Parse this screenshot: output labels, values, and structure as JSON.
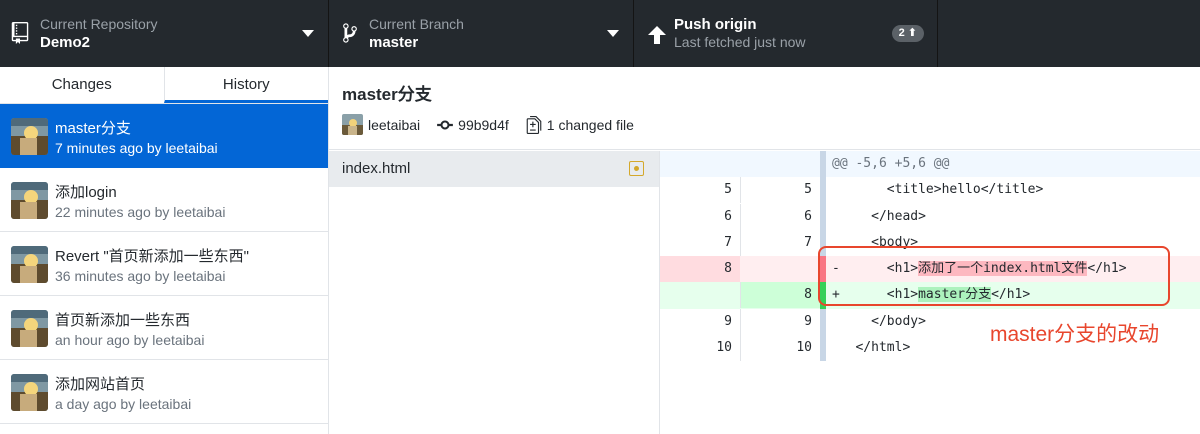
{
  "toolbar": {
    "repo": {
      "title": "Current Repository",
      "value": "Demo2",
      "icon": "repo-icon"
    },
    "branch": {
      "title": "Current Branch",
      "value": "master",
      "icon": "branch-icon"
    },
    "push": {
      "title": "Push origin",
      "subtitle": "Last fetched just now",
      "badge": "2",
      "icon": "arrow-up-icon"
    }
  },
  "tabs": {
    "changes": "Changes",
    "history": "History",
    "active": "History"
  },
  "commits": [
    {
      "title": "master分支",
      "meta": "7 minutes ago by leetaibai"
    },
    {
      "title": "添加login",
      "meta": "22 minutes ago by leetaibai"
    },
    {
      "title": "Revert \"首页新添加一些东西\"",
      "meta": "36 minutes ago by leetaibai"
    },
    {
      "title": "首页新添加一些东西",
      "meta": "an hour ago by leetaibai"
    },
    {
      "title": "添加网站首页",
      "meta": "a day ago by leetaibai"
    }
  ],
  "commit_detail": {
    "title": "master分支",
    "author": "leetaibai",
    "sha": "99b9d4f",
    "changed": "1 changed file"
  },
  "files": [
    {
      "name": "index.html",
      "status": "modified"
    }
  ],
  "diff": {
    "hunk": "@@ -5,6 +5,6 @@",
    "lines": [
      {
        "old": "5",
        "new": "5",
        "prefix": " ",
        "text": "    <title>hello</title>"
      },
      {
        "old": "6",
        "new": "6",
        "prefix": " ",
        "text": "  </head>"
      },
      {
        "old": "7",
        "new": "7",
        "prefix": " ",
        "text": "  <body>"
      },
      {
        "old": "8",
        "new": "",
        "prefix": "-",
        "pre": "    <h1>",
        "hl": "添加了一个index.html文件",
        "post": "</h1>"
      },
      {
        "old": "",
        "new": "8",
        "prefix": "+",
        "pre": "    <h1>",
        "hl": "master分支",
        "post": "</h1>"
      },
      {
        "old": "9",
        "new": "9",
        "prefix": " ",
        "text": "  </body>"
      },
      {
        "old": "10",
        "new": "10",
        "prefix": " ",
        "text": "</html>"
      }
    ]
  },
  "annotation": {
    "text": "master分支的改动",
    "color": "#e8462d"
  },
  "colors": {
    "toolbar": "#24292e",
    "accent": "#0366d6"
  }
}
